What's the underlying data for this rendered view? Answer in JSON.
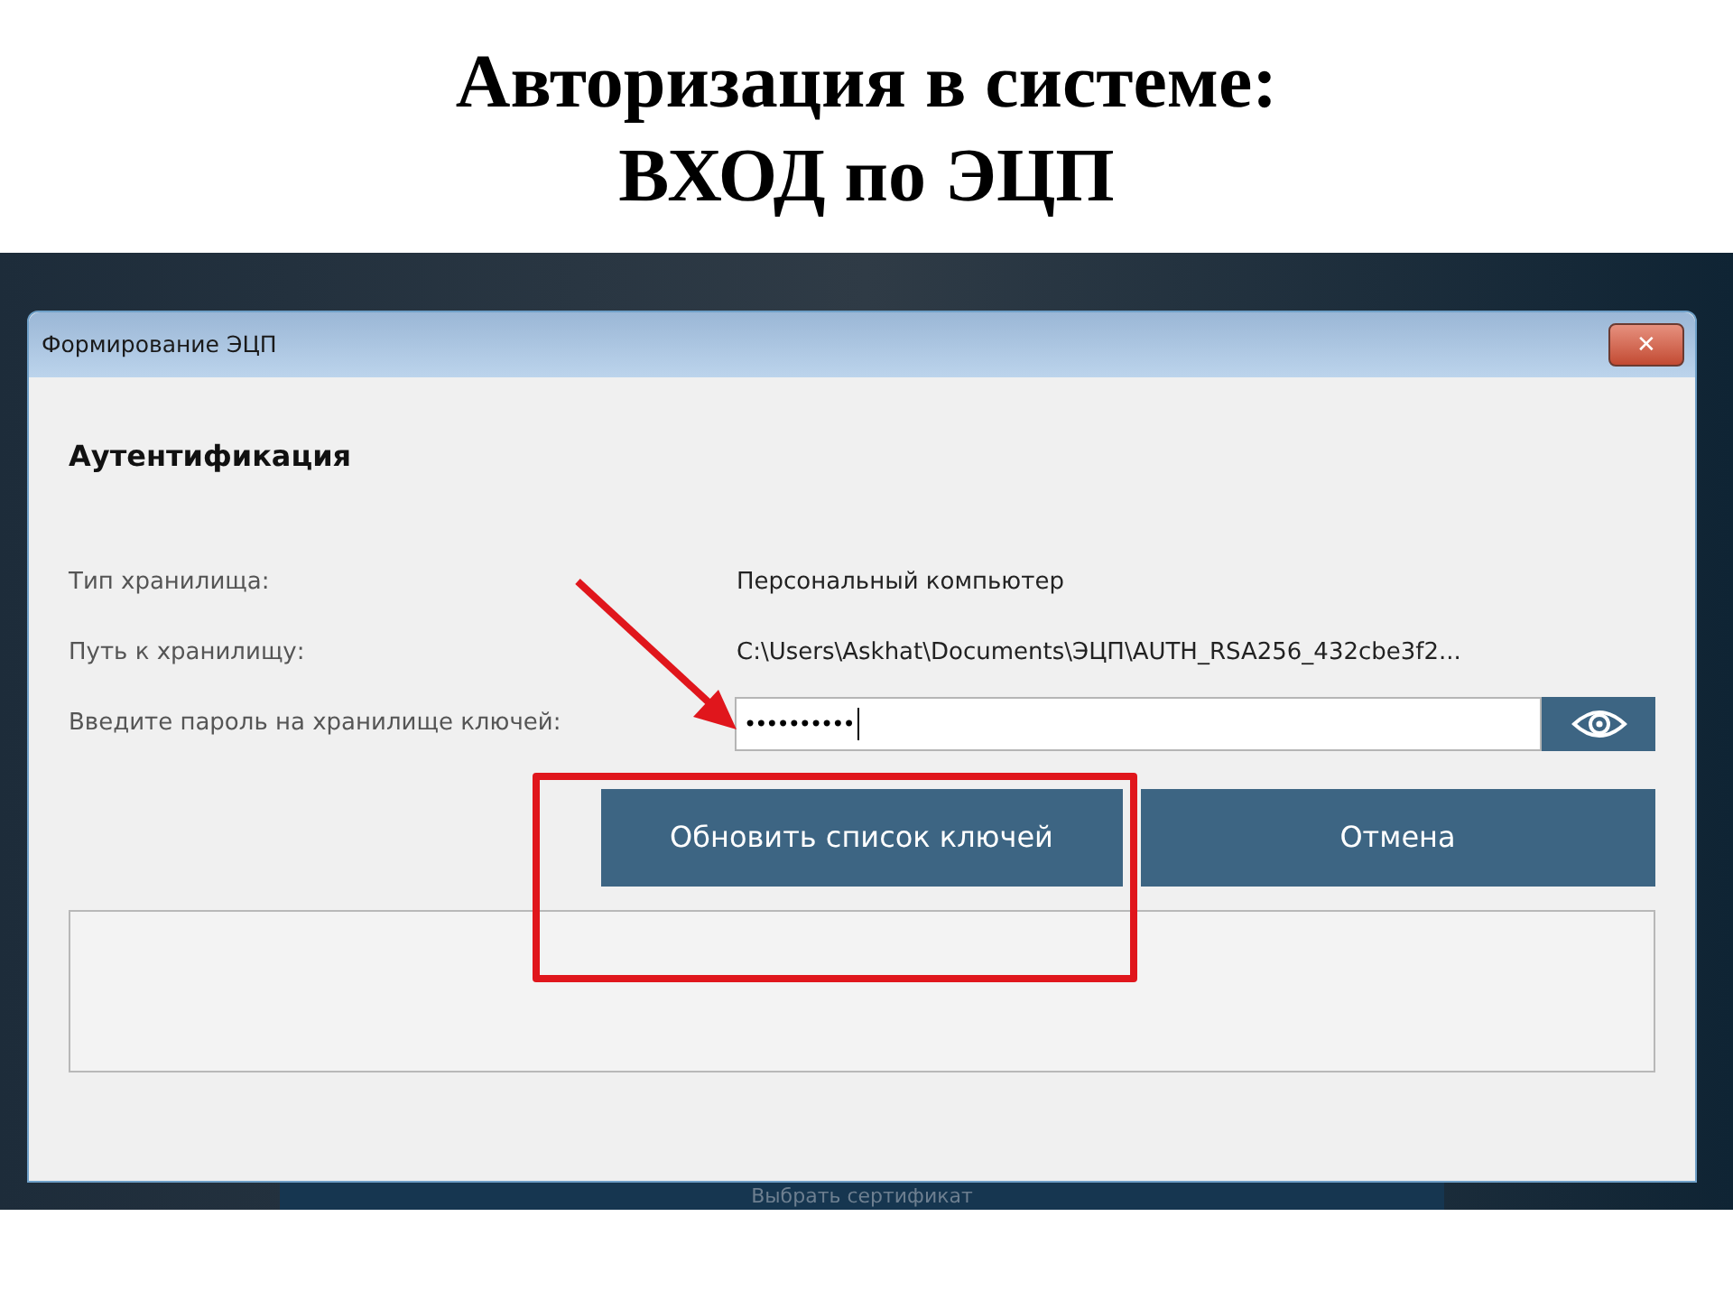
{
  "slide_title": [
    "Авторизация в системе:",
    "ВХОД по ЭЦП"
  ],
  "window": {
    "title": "Формирование ЭЦП",
    "close": "✕"
  },
  "heading": "Аутентификация",
  "fields": [
    {
      "kind": "text",
      "label": "Тип хранилища:",
      "value": "Персональный компьютер"
    },
    {
      "kind": "text",
      "label": "Путь к хранилищу:",
      "value": "C:\\Users\\Askhat\\Documents\\ЭЦП\\AUTH_RSA256_432cbe3f2..."
    },
    {
      "kind": "password",
      "label": "Введите пароль на хранилище ключей:",
      "value": "••••••••••"
    }
  ],
  "buttons": [
    "Обновить список ключей",
    "Отмена"
  ],
  "background_button": "Выбрать сертификат"
}
